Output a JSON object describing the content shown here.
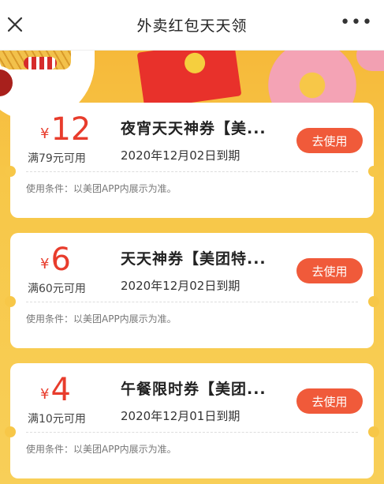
{
  "header": {
    "title": "外卖红包天天领",
    "close_icon": "close-icon",
    "more_icon": "more-dots-icon",
    "more_glyph": "•••"
  },
  "colors": {
    "accent": "#f05a3a",
    "amount": "#e83c2c",
    "background": "#f7c748"
  },
  "coupons": [
    {
      "currency": "¥",
      "amount": "12",
      "condition": "满79元可用",
      "name": "夜宵天天神券【美...",
      "expire": "2020年12月02日到期",
      "button": "去使用",
      "note": "使用条件：以美团APP内展示为准。"
    },
    {
      "currency": "¥",
      "amount": "6",
      "condition": "满60元可用",
      "name": "天天神券【美团特...",
      "expire": "2020年12月02日到期",
      "button": "去使用",
      "note": "使用条件：以美团APP内展示为准。"
    },
    {
      "currency": "¥",
      "amount": "4",
      "condition": "满10元可用",
      "name": "午餐限时券【美团...",
      "expire": "2020年12月01日到期",
      "button": "去使用",
      "note": "使用条件：以美团APP内展示为准。"
    }
  ]
}
